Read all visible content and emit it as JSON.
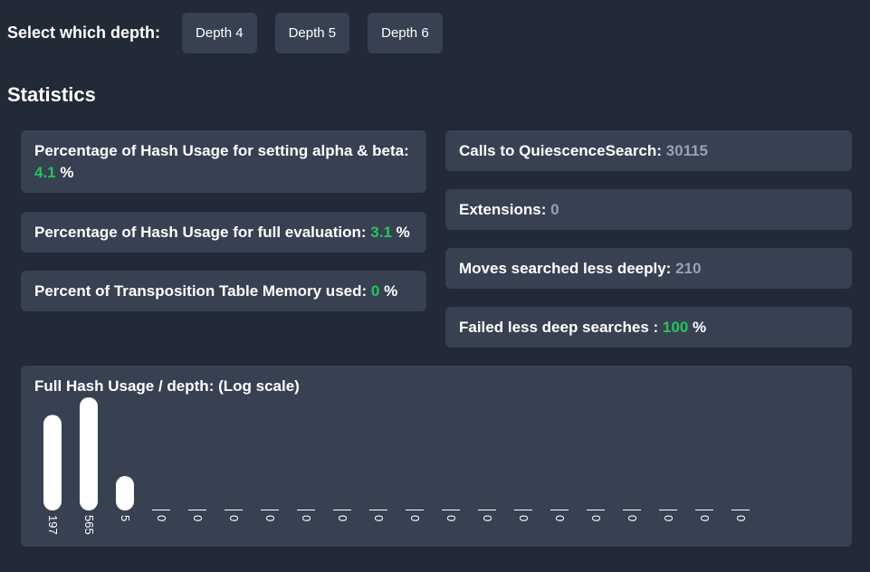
{
  "header": {
    "select_label": "Select which depth:",
    "buttons": [
      "Depth 4",
      "Depth 5",
      "Depth 6"
    ]
  },
  "stats_title": "Statistics",
  "left_stats": [
    {
      "label": "Percentage of Hash Usage for setting alpha & beta:",
      "value": "4.1",
      "suffix": " %"
    },
    {
      "label": "Percentage of Hash Usage for full evaluation:",
      "value": "3.1",
      "suffix": " %"
    },
    {
      "label": "Percent of Transposition Table Memory used:",
      "value": "0",
      "suffix": " %"
    }
  ],
  "right_stats": [
    {
      "label": "Calls to QuiescenceSearch:",
      "value": "30115",
      "suffix": ""
    },
    {
      "label": "Extensions:",
      "value": "0",
      "suffix": ""
    },
    {
      "label": "Moves searched less deeply:",
      "value": "210",
      "suffix": ""
    },
    {
      "label": "Failed less deep searches :",
      "value": "100",
      "suffix": " %"
    }
  ],
  "colors": {
    "background": "#222937",
    "card": "#384152",
    "green_value": "#22c55e",
    "grey_value": "#94a3b8",
    "bar": "#ffffff"
  },
  "chart_data": {
    "type": "bar",
    "title": "Full Hash Usage / depth: (Log scale)",
    "scale": "log",
    "values": [
      197,
      565,
      5,
      0,
      0,
      0,
      0,
      0,
      0,
      0,
      0,
      0,
      0,
      0,
      0,
      0,
      0,
      0,
      0,
      0
    ]
  }
}
